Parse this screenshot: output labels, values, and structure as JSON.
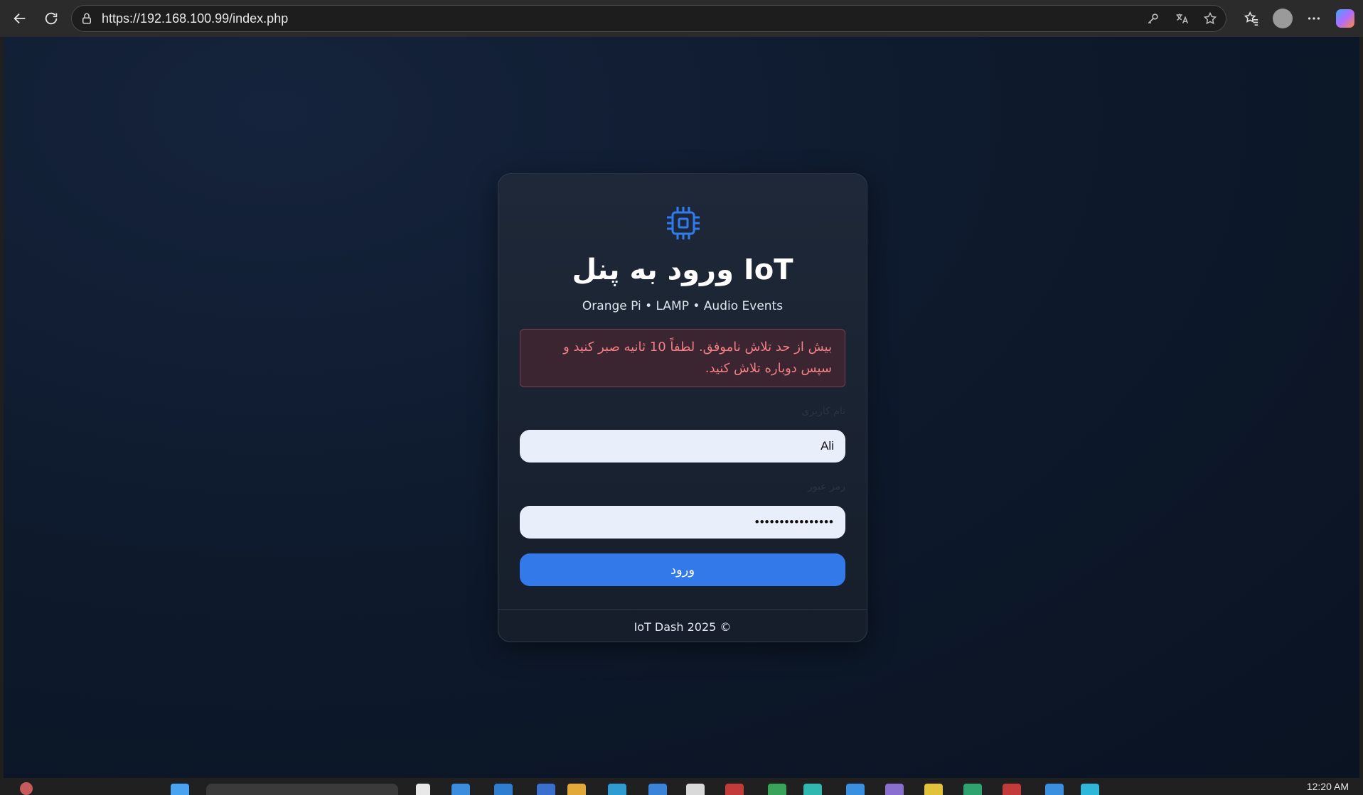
{
  "browser": {
    "url": "https://192.168.100.99/index.php",
    "icons": {
      "back": "back-arrow-icon",
      "refresh": "refresh-icon",
      "lock": "lock-icon",
      "key": "key-icon",
      "read_aloud": "read-aloud-icon",
      "favorite": "star-icon",
      "favorites": "favorites-icon",
      "profile": "profile-icon",
      "more": "more-icon",
      "copilot": "copilot-icon"
    }
  },
  "login": {
    "title": "ورود به پنل IoT",
    "subtitle": "Orange Pi • LAMP • Audio Events",
    "error": "بیش از حد تلاش ناموفق. لطفاً 10 ثانیه صبر کنید و سپس دوباره تلاش کنید.",
    "username_label": "نام کاربری",
    "username_value": "Ali",
    "password_label": "رمز عبور",
    "password_value": "••••••••••••••••",
    "submit_label": "ورود",
    "footer": "IoT Dash 2025 ©",
    "accent_color": "#3379ea",
    "error_color": "#f47f86"
  },
  "taskbar": {
    "clock": "12:20 AM"
  }
}
